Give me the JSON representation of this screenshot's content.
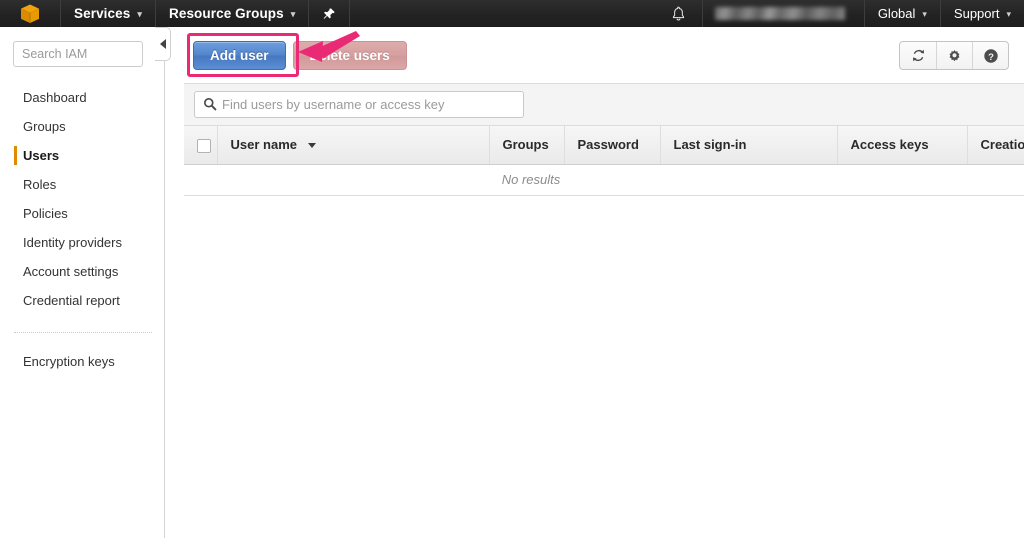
{
  "topnav": {
    "logo_icon": "aws-cube-icon",
    "services_label": "Services",
    "resource_groups_label": "Resource Groups",
    "pin_icon": "pushpin-icon",
    "bell_icon": "bell-icon",
    "account_label": "",
    "region_label": "Global",
    "support_label": "Support",
    "caret": "▾"
  },
  "sidebar": {
    "search_placeholder": "Search IAM",
    "search_value": "",
    "collapse_icon": "collapse-left-icon",
    "items": [
      {
        "label": "Dashboard",
        "active": false
      },
      {
        "label": "Groups",
        "active": false
      },
      {
        "label": "Users",
        "active": true
      },
      {
        "label": "Roles",
        "active": false
      },
      {
        "label": "Policies",
        "active": false
      },
      {
        "label": "Identity providers",
        "active": false
      },
      {
        "label": "Account settings",
        "active": false
      },
      {
        "label": "Credential report",
        "active": false
      }
    ],
    "items_after_divider": [
      {
        "label": "Encryption keys",
        "active": false
      }
    ]
  },
  "toolbar": {
    "add_user_label": "Add user",
    "delete_users_label": "Delete users",
    "refresh_icon": "refresh-icon",
    "settings_icon": "gear-icon",
    "help_icon": "help-icon"
  },
  "annotation": {
    "highlight_color": "#eb2a75",
    "arrow_color": "#eb2a75",
    "target": "Add user"
  },
  "table": {
    "search_placeholder": "Find users by username or access key",
    "search_value": "",
    "search_icon": "search-icon",
    "columns": [
      "User name",
      "Groups",
      "Password",
      "Last sign-in",
      "Access keys",
      "Creation time"
    ],
    "sorted_column": "User name",
    "rows": [],
    "empty_message": "No results"
  },
  "colors": {
    "nav_background": "#232323",
    "accent_orange": "#e08a00",
    "primary_button": "#5184cc",
    "annotation_pink": "#eb2a75"
  }
}
